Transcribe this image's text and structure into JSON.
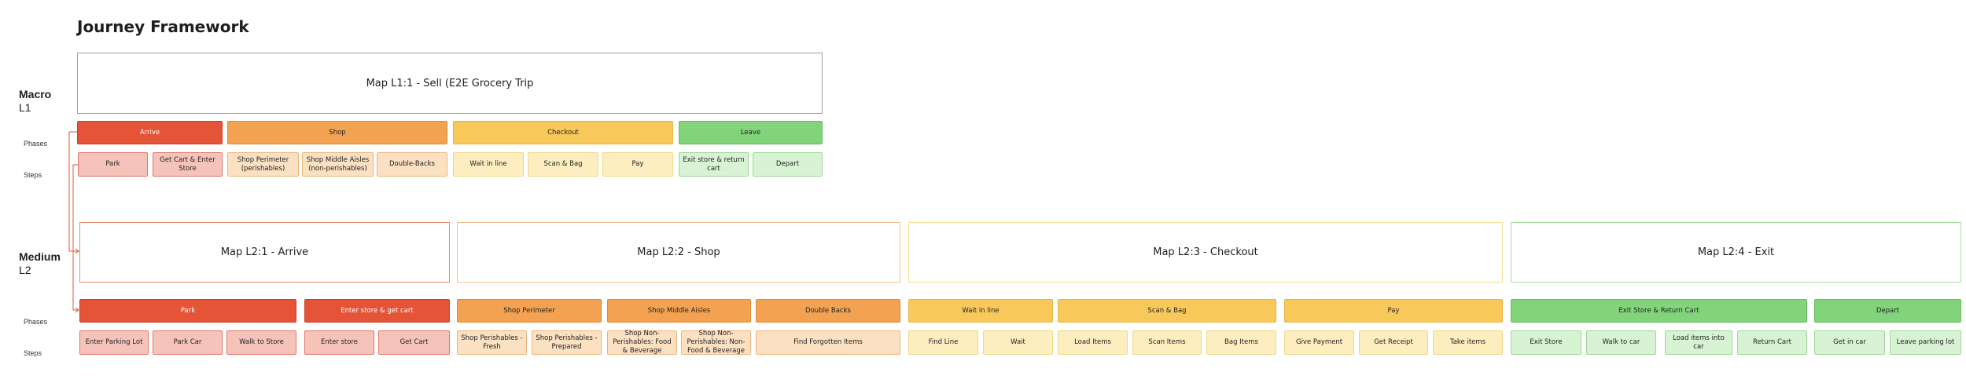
{
  "title": "Journey Framework",
  "levels": {
    "macro": {
      "name": "Macro",
      "code": "L1"
    },
    "medium": {
      "name": "Medium",
      "code": "L2"
    }
  },
  "row_labels": {
    "phases": "Phases",
    "steps": "Steps"
  },
  "l1": {
    "map": "Map L1:1 - Sell (E2E Grocery Trip",
    "phases": [
      "Arrive",
      "Shop",
      "Checkout",
      "Leave"
    ],
    "steps": [
      "Park",
      "Get Cart & Enter Store",
      "Shop Perimeter (perishables)",
      "Shop Middle Aisles (non-perishables)",
      "Double-Backs",
      "Wait in line",
      "Scan & Bag",
      "Pay",
      "Exit store & return cart",
      "Depart"
    ]
  },
  "l2": {
    "maps": [
      "Map L2:1 - Arrive",
      "Map L2:2 - Shop",
      "Map L2:3 - Checkout",
      "Map L2:4 - Exit"
    ],
    "phases": [
      "Park",
      "Enter store & get cart",
      "Shop Perimeter",
      "Shop Middle Aisles",
      "Double Backs",
      "Wait in line",
      "Scan & Bag",
      "Pay",
      "Exit Store & Return Cart",
      "Depart"
    ],
    "steps": [
      "Enter Parking Lot",
      "Park Car",
      "Walk to Store",
      "Enter store",
      "Get Cart",
      "Shop Perishables - Fresh",
      "Shop Perishables - Prepared",
      "Shop Non-Perishables: Food & Beverage",
      "Shop Non-Perishables: Non-Food & Beverage",
      "Find Forgotten Items",
      "Find Line",
      "Wait",
      "Load Items",
      "Scan Items",
      "Bag Items",
      "Give Payment",
      "Get Receipt",
      "Take items",
      "Exit Store",
      "Walk to car",
      "Load items into car",
      "Return Cart",
      "Get in car",
      "Leave parking lot"
    ]
  },
  "colors": {
    "arrive": "#e55437",
    "shop": "#f2a250",
    "checkout": "#f8c95a",
    "leave": "#82d47a"
  }
}
